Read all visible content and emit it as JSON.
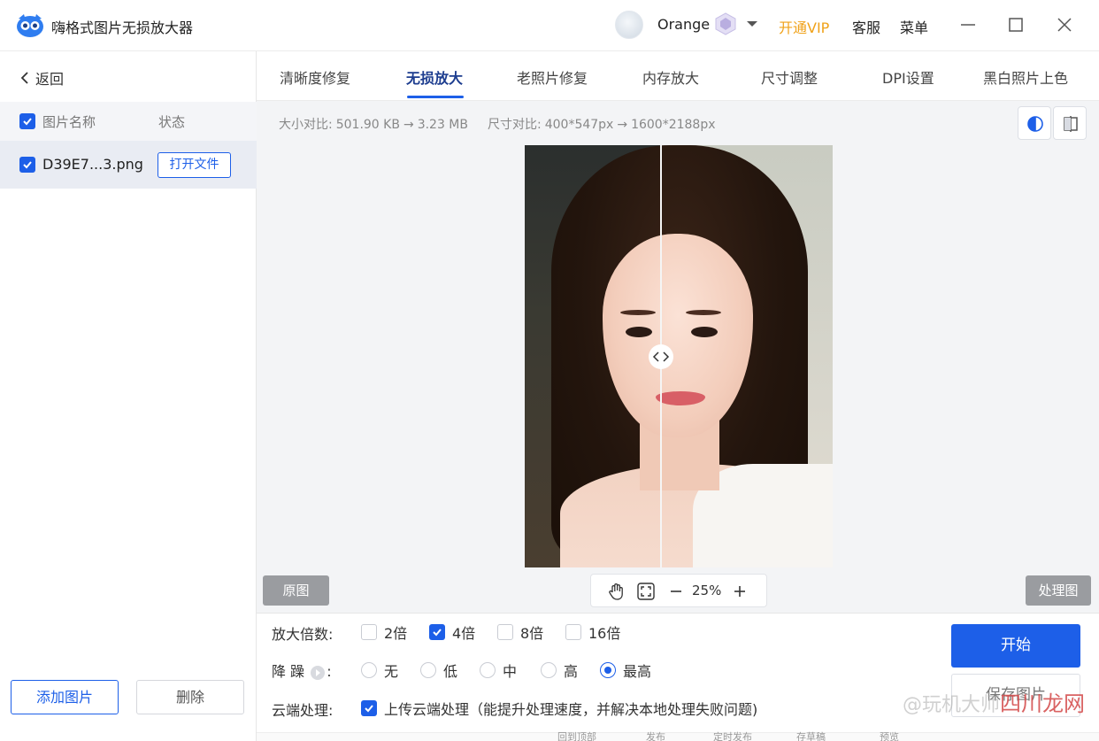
{
  "app": {
    "title": "嗨格式图片无损放大器",
    "user_name": "Orange",
    "vip_link": "开通VIP",
    "service_link": "客服",
    "menu_link": "菜单"
  },
  "sidebar": {
    "back_label": "返回",
    "col_name": "图片名称",
    "col_status": "状态",
    "files": [
      {
        "name": "D39E7...3.png",
        "action": "打开文件",
        "checked": true
      }
    ],
    "add_button": "添加图片",
    "delete_button": "删除"
  },
  "tabs": [
    {
      "label": "清晰度修复"
    },
    {
      "label": "无损放大",
      "active": true
    },
    {
      "label": "老照片修复"
    },
    {
      "label": "内存放大"
    },
    {
      "label": "尺寸调整"
    },
    {
      "label": "DPI设置"
    },
    {
      "label": "黑白照片上色"
    }
  ],
  "preview": {
    "size_label": "大小对比:",
    "size_from": "501.90 KB",
    "size_to": "3.23 MB",
    "dim_label": "尺寸对比:",
    "dim_from": "400*547px",
    "dim_to": "1600*2188px",
    "original_label": "原图",
    "processed_label": "处理图",
    "zoom": "25%"
  },
  "options": {
    "scale_label": "放大倍数:",
    "scale_options": [
      {
        "label": "2倍",
        "checked": false
      },
      {
        "label": "4倍",
        "checked": true
      },
      {
        "label": "8倍",
        "checked": false
      },
      {
        "label": "16倍",
        "checked": false
      }
    ],
    "denoise_label_a": "降 躁",
    "denoise_label_b": ":",
    "denoise_options": [
      {
        "label": "无",
        "selected": false
      },
      {
        "label": "低",
        "selected": false
      },
      {
        "label": "中",
        "selected": false
      },
      {
        "label": "高",
        "selected": false
      },
      {
        "label": "最高",
        "selected": true
      }
    ],
    "cloud_label": "云端处理:",
    "cloud_option": "上传云端处理（能提升处理速度，并解决本地处理失败问题)",
    "cloud_checked": true,
    "start_button": "开始",
    "save_button": "保存图片"
  },
  "watermark": {
    "text": "@玩机大师",
    "brand": "四川龙网"
  },
  "bottom_strip": [
    "回到顶部",
    "发布",
    "定时发布",
    "存草稿",
    "预览"
  ],
  "colors": {
    "accent": "#1d5fe8",
    "vip": "#f0a21a"
  }
}
